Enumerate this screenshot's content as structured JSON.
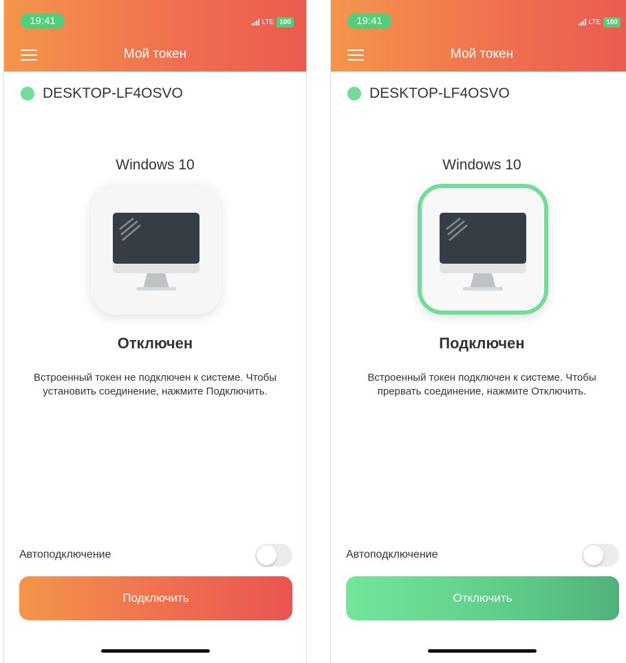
{
  "left_screen": {
    "status_bar": {
      "time": "19:41",
      "network": "LTE",
      "battery": "100"
    },
    "header": {
      "title": "Мой токен",
      "menu_icon": "hamburger-menu-icon"
    },
    "device": {
      "name": "DESKTOP-LF4OSVO",
      "status_color": "#72dd97"
    },
    "os_name": "Windows 10",
    "state_title": "Отключен",
    "state_description": "Встроенный токен не подключен к системе. Чтобы установить соединение, нажмите Подключить.",
    "auto_connect": {
      "label": "Автоподключение",
      "enabled": false
    },
    "action_button": {
      "label": "Подключить",
      "color": "#ef6e4f"
    }
  },
  "right_screen": {
    "status_bar": {
      "time": "19:41",
      "network": "LTE",
      "battery": "100"
    },
    "header": {
      "title": "Мой токен",
      "menu_icon": "hamburger-menu-icon"
    },
    "device": {
      "name": "DESKTOP-LF4OSVO",
      "status_color": "#72dd97"
    },
    "os_name": "Windows 10",
    "state_title": "Подключен",
    "state_description": "Встроенный токен подключен к системе. Чтобы прервать соединение, нажмите  Отключить.",
    "auto_connect": {
      "label": "Автоподключение",
      "enabled": false
    },
    "action_button": {
      "label": "Отключить",
      "color": "#5dc987"
    }
  }
}
